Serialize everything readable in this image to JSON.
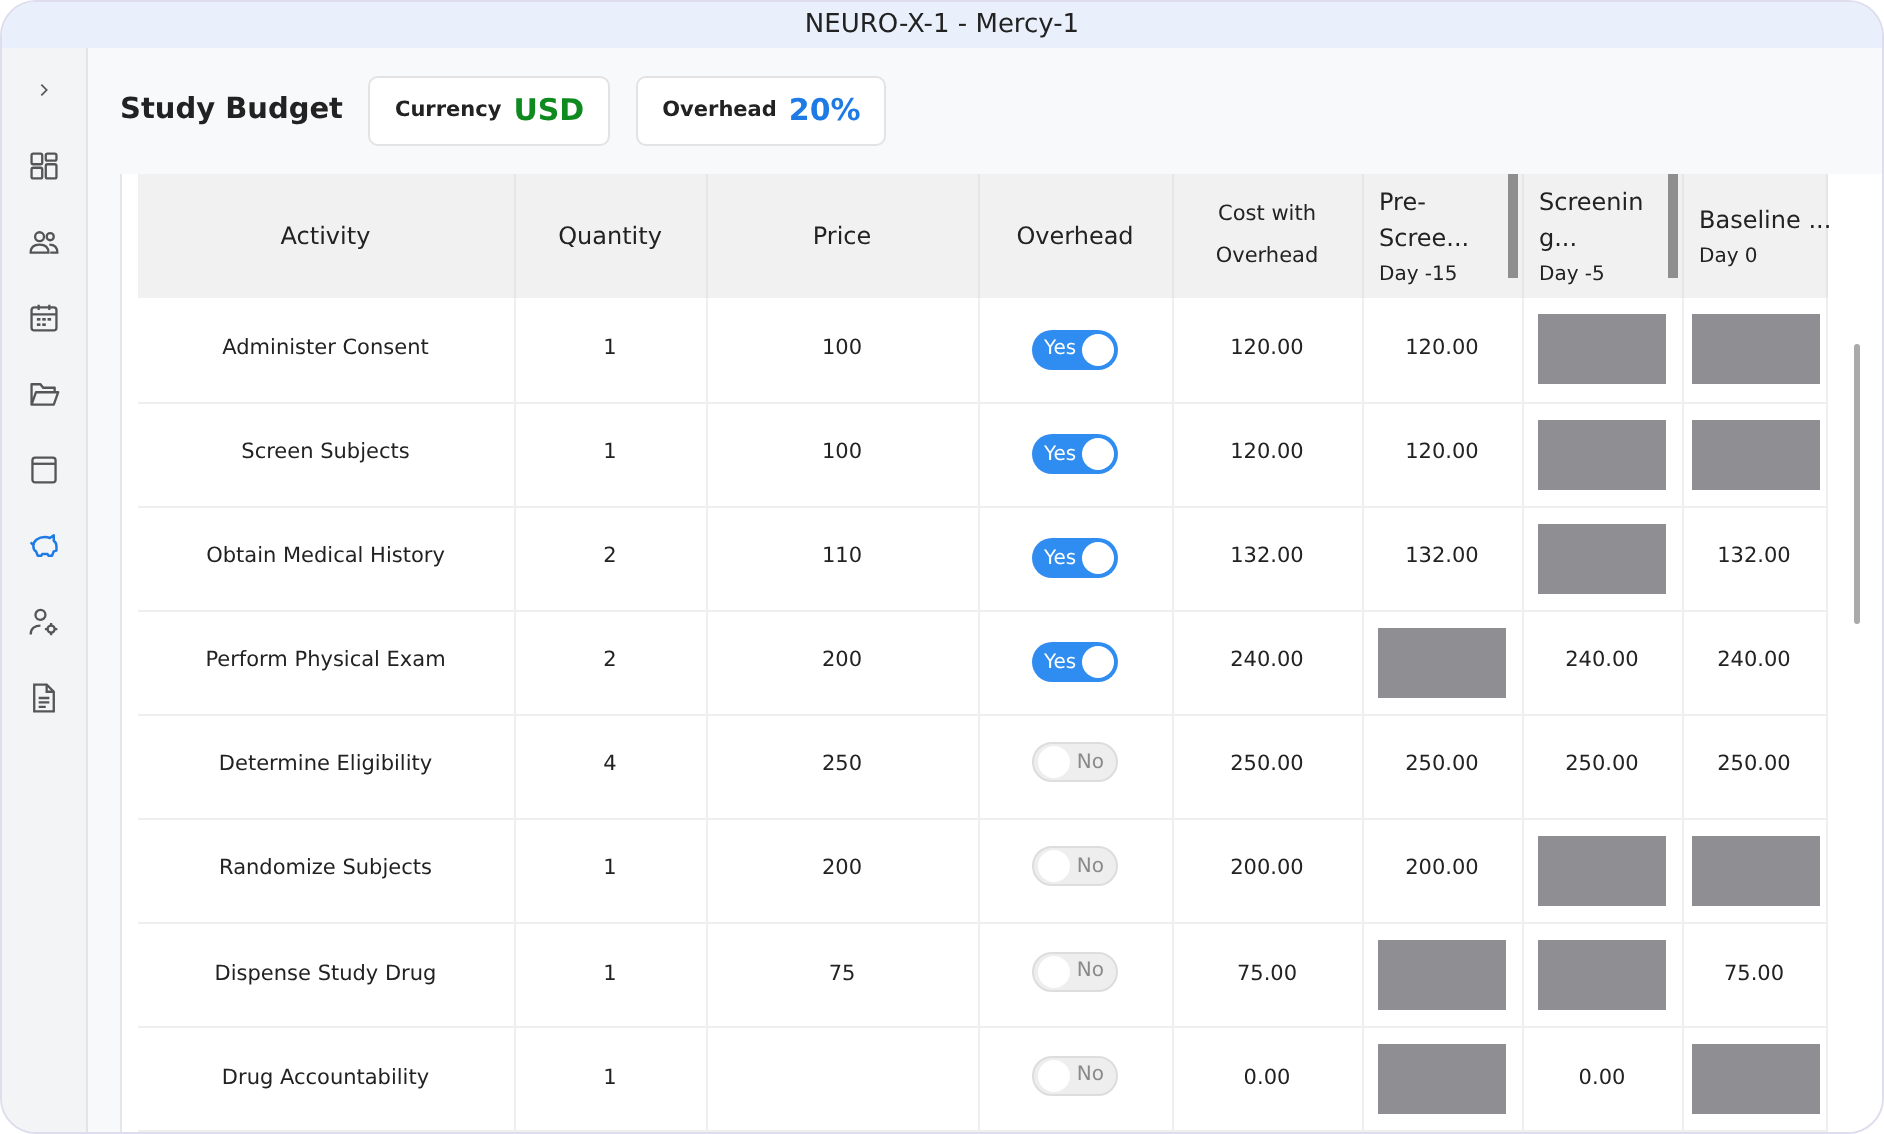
{
  "window": {
    "title": "NEURO-X-1 - Mercy-1"
  },
  "sidebar": {
    "items": [
      {
        "kind": "expand",
        "selected": false
      },
      {
        "kind": "dashboard",
        "selected": false
      },
      {
        "kind": "people",
        "selected": false
      },
      {
        "kind": "calendar",
        "selected": false
      },
      {
        "kind": "folder",
        "selected": false
      },
      {
        "kind": "archive",
        "selected": false
      },
      {
        "kind": "budget",
        "selected": true
      },
      {
        "kind": "user-settings",
        "selected": false
      },
      {
        "kind": "document",
        "selected": false
      }
    ]
  },
  "header": {
    "title": "Study Budget",
    "chips": [
      {
        "label": "Currency",
        "value": "USD",
        "color": "#0f8a1e"
      },
      {
        "label": "Overhead",
        "value": "20%",
        "color": "#1e7be6"
      }
    ]
  },
  "table": {
    "columns": [
      {
        "title": "Activity"
      },
      {
        "title": "Quantity"
      },
      {
        "title": "Price"
      },
      {
        "title": "Overhead"
      },
      {
        "title": "Cost with Overhead"
      },
      {
        "title": "Pre-\nScree...",
        "subtitle": "Day -15",
        "resizable": true
      },
      {
        "title": "Screenin\ng...",
        "subtitle": "Day -5",
        "resizable": true
      },
      {
        "title": "Baseline ...",
        "subtitle": "Day 0",
        "resizable": false
      }
    ],
    "rows": [
      {
        "activity": "Administer Consent",
        "quantity": "1",
        "price": "100",
        "overhead": true,
        "overhead_label": "Yes",
        "cost": "120.00",
        "visits": [
          {
            "blocked": false,
            "value": "120.00"
          },
          {
            "blocked": true
          },
          {
            "blocked": true
          }
        ]
      },
      {
        "activity": "Screen Subjects",
        "quantity": "1",
        "price": "100",
        "overhead": true,
        "overhead_label": "Yes",
        "cost": "120.00",
        "visits": [
          {
            "blocked": false,
            "value": "120.00"
          },
          {
            "blocked": true
          },
          {
            "blocked": true
          }
        ]
      },
      {
        "activity": "Obtain Medical History",
        "quantity": "2",
        "price": "110",
        "overhead": true,
        "overhead_label": "Yes",
        "cost": "132.00",
        "visits": [
          {
            "blocked": false,
            "value": "132.00"
          },
          {
            "blocked": true
          },
          {
            "blocked": false,
            "value": "132.00"
          }
        ]
      },
      {
        "activity": "Perform Physical Exam",
        "quantity": "2",
        "price": "200",
        "overhead": true,
        "overhead_label": "Yes",
        "cost": "240.00",
        "visits": [
          {
            "blocked": true
          },
          {
            "blocked": false,
            "value": "240.00"
          },
          {
            "blocked": false,
            "value": "240.00"
          }
        ]
      },
      {
        "activity": "Determine Eligibility",
        "quantity": "4",
        "price": "250",
        "overhead": false,
        "overhead_label": "No",
        "cost": "250.00",
        "visits": [
          {
            "blocked": false,
            "value": "250.00"
          },
          {
            "blocked": false,
            "value": "250.00"
          },
          {
            "blocked": false,
            "value": "250.00"
          }
        ]
      },
      {
        "activity": "Randomize Subjects",
        "quantity": "1",
        "price": "200",
        "overhead": false,
        "overhead_label": "No",
        "cost": "200.00",
        "visits": [
          {
            "blocked": false,
            "value": "200.00"
          },
          {
            "blocked": true
          },
          {
            "blocked": true
          }
        ]
      },
      {
        "activity": "Dispense Study Drug",
        "quantity": "1",
        "price": "75",
        "overhead": false,
        "overhead_label": "No",
        "cost": "75.00",
        "visits": [
          {
            "blocked": true
          },
          {
            "blocked": true
          },
          {
            "blocked": false,
            "value": "75.00"
          }
        ]
      },
      {
        "activity": "Drug Accountability",
        "quantity": "1",
        "overhead": false,
        "overhead_label": "No",
        "cost": "0.00",
        "visits": [
          {
            "blocked": true
          },
          {
            "blocked": false,
            "value": "0.00"
          },
          {
            "blocked": true
          }
        ]
      }
    ]
  }
}
